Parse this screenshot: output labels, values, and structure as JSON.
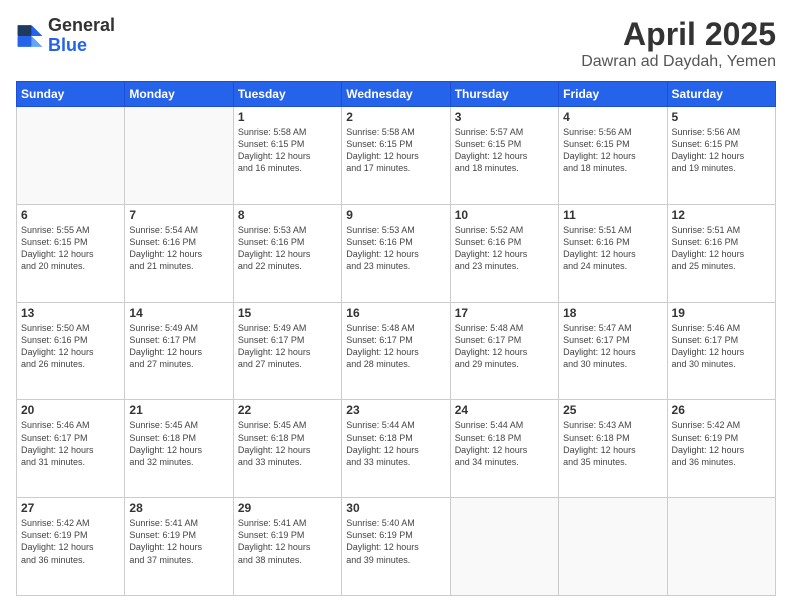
{
  "logo": {
    "general": "General",
    "blue": "Blue"
  },
  "header": {
    "title": "April 2025",
    "subtitle": "Dawran ad Daydah, Yemen"
  },
  "weekdays": [
    "Sunday",
    "Monday",
    "Tuesday",
    "Wednesday",
    "Thursday",
    "Friday",
    "Saturday"
  ],
  "weeks": [
    [
      null,
      null,
      {
        "day": "1",
        "sunrise": "5:58 AM",
        "sunset": "6:15 PM",
        "daylight": "12 hours and 16 minutes."
      },
      {
        "day": "2",
        "sunrise": "5:58 AM",
        "sunset": "6:15 PM",
        "daylight": "12 hours and 17 minutes."
      },
      {
        "day": "3",
        "sunrise": "5:57 AM",
        "sunset": "6:15 PM",
        "daylight": "12 hours and 18 minutes."
      },
      {
        "day": "4",
        "sunrise": "5:56 AM",
        "sunset": "6:15 PM",
        "daylight": "12 hours and 18 minutes."
      },
      {
        "day": "5",
        "sunrise": "5:56 AM",
        "sunset": "6:15 PM",
        "daylight": "12 hours and 19 minutes."
      }
    ],
    [
      {
        "day": "6",
        "sunrise": "5:55 AM",
        "sunset": "6:15 PM",
        "daylight": "12 hours and 20 minutes."
      },
      {
        "day": "7",
        "sunrise": "5:54 AM",
        "sunset": "6:16 PM",
        "daylight": "12 hours and 21 minutes."
      },
      {
        "day": "8",
        "sunrise": "5:53 AM",
        "sunset": "6:16 PM",
        "daylight": "12 hours and 22 minutes."
      },
      {
        "day": "9",
        "sunrise": "5:53 AM",
        "sunset": "6:16 PM",
        "daylight": "12 hours and 23 minutes."
      },
      {
        "day": "10",
        "sunrise": "5:52 AM",
        "sunset": "6:16 PM",
        "daylight": "12 hours and 23 minutes."
      },
      {
        "day": "11",
        "sunrise": "5:51 AM",
        "sunset": "6:16 PM",
        "daylight": "12 hours and 24 minutes."
      },
      {
        "day": "12",
        "sunrise": "5:51 AM",
        "sunset": "6:16 PM",
        "daylight": "12 hours and 25 minutes."
      }
    ],
    [
      {
        "day": "13",
        "sunrise": "5:50 AM",
        "sunset": "6:16 PM",
        "daylight": "12 hours and 26 minutes."
      },
      {
        "day": "14",
        "sunrise": "5:49 AM",
        "sunset": "6:17 PM",
        "daylight": "12 hours and 27 minutes."
      },
      {
        "day": "15",
        "sunrise": "5:49 AM",
        "sunset": "6:17 PM",
        "daylight": "12 hours and 27 minutes."
      },
      {
        "day": "16",
        "sunrise": "5:48 AM",
        "sunset": "6:17 PM",
        "daylight": "12 hours and 28 minutes."
      },
      {
        "day": "17",
        "sunrise": "5:48 AM",
        "sunset": "6:17 PM",
        "daylight": "12 hours and 29 minutes."
      },
      {
        "day": "18",
        "sunrise": "5:47 AM",
        "sunset": "6:17 PM",
        "daylight": "12 hours and 30 minutes."
      },
      {
        "day": "19",
        "sunrise": "5:46 AM",
        "sunset": "6:17 PM",
        "daylight": "12 hours and 30 minutes."
      }
    ],
    [
      {
        "day": "20",
        "sunrise": "5:46 AM",
        "sunset": "6:17 PM",
        "daylight": "12 hours and 31 minutes."
      },
      {
        "day": "21",
        "sunrise": "5:45 AM",
        "sunset": "6:18 PM",
        "daylight": "12 hours and 32 minutes."
      },
      {
        "day": "22",
        "sunrise": "5:45 AM",
        "sunset": "6:18 PM",
        "daylight": "12 hours and 33 minutes."
      },
      {
        "day": "23",
        "sunrise": "5:44 AM",
        "sunset": "6:18 PM",
        "daylight": "12 hours and 33 minutes."
      },
      {
        "day": "24",
        "sunrise": "5:44 AM",
        "sunset": "6:18 PM",
        "daylight": "12 hours and 34 minutes."
      },
      {
        "day": "25",
        "sunrise": "5:43 AM",
        "sunset": "6:18 PM",
        "daylight": "12 hours and 35 minutes."
      },
      {
        "day": "26",
        "sunrise": "5:42 AM",
        "sunset": "6:19 PM",
        "daylight": "12 hours and 36 minutes."
      }
    ],
    [
      {
        "day": "27",
        "sunrise": "5:42 AM",
        "sunset": "6:19 PM",
        "daylight": "12 hours and 36 minutes."
      },
      {
        "day": "28",
        "sunrise": "5:41 AM",
        "sunset": "6:19 PM",
        "daylight": "12 hours and 37 minutes."
      },
      {
        "day": "29",
        "sunrise": "5:41 AM",
        "sunset": "6:19 PM",
        "daylight": "12 hours and 38 minutes."
      },
      {
        "day": "30",
        "sunrise": "5:40 AM",
        "sunset": "6:19 PM",
        "daylight": "12 hours and 39 minutes."
      },
      null,
      null,
      null
    ]
  ],
  "labels": {
    "sunrise": "Sunrise:",
    "sunset": "Sunset:",
    "daylight": "Daylight:"
  }
}
